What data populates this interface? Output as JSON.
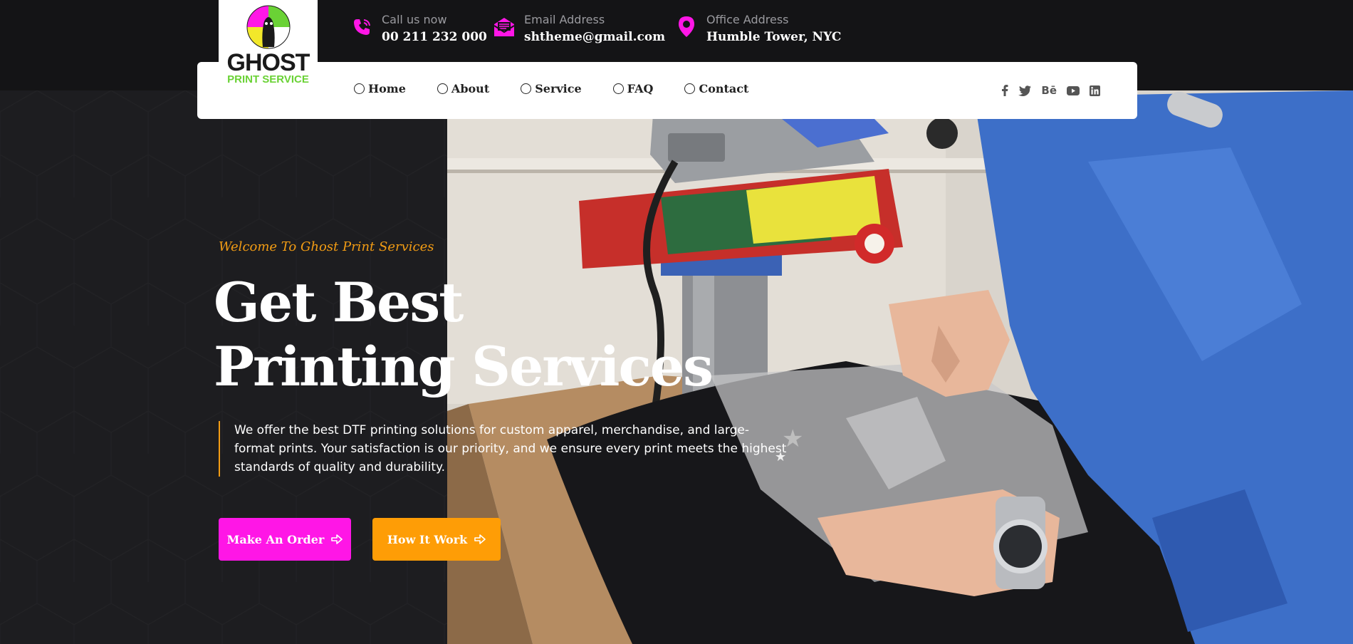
{
  "logo": {
    "word": "GHOST",
    "sub": "PRINT SERVICE"
  },
  "contact": [
    {
      "label": "Call us now",
      "value": "00 211 232 000",
      "icon": "phone-icon"
    },
    {
      "label": "Email Address",
      "value": "shtheme@gmail.com",
      "icon": "envelope-icon"
    },
    {
      "label": "Office Address",
      "value": "Humble Tower, NYC",
      "icon": "location-pin-icon"
    }
  ],
  "nav": {
    "items": [
      "Home",
      "About",
      "Service",
      "FAQ",
      "Contact"
    ]
  },
  "social": {
    "behance": "Bē"
  },
  "hero": {
    "welcome": "Welcome To Ghost Print Services",
    "title_line1": "Get Best",
    "title_line2": "Printing Services",
    "description": "We offer the best DTF printing solutions for custom apparel, merchandise, and large-format prints. Your satisfaction is our priority, and we ensure every print meets the highest standards of quality and durability.",
    "btn_order": "Make An Order",
    "btn_how": "How It Work"
  },
  "colors": {
    "accent_pink": "#ff16e6",
    "accent_orange": "#fe9d06",
    "welcome_text": "#f29c14",
    "logo_green": "#6ad235"
  }
}
